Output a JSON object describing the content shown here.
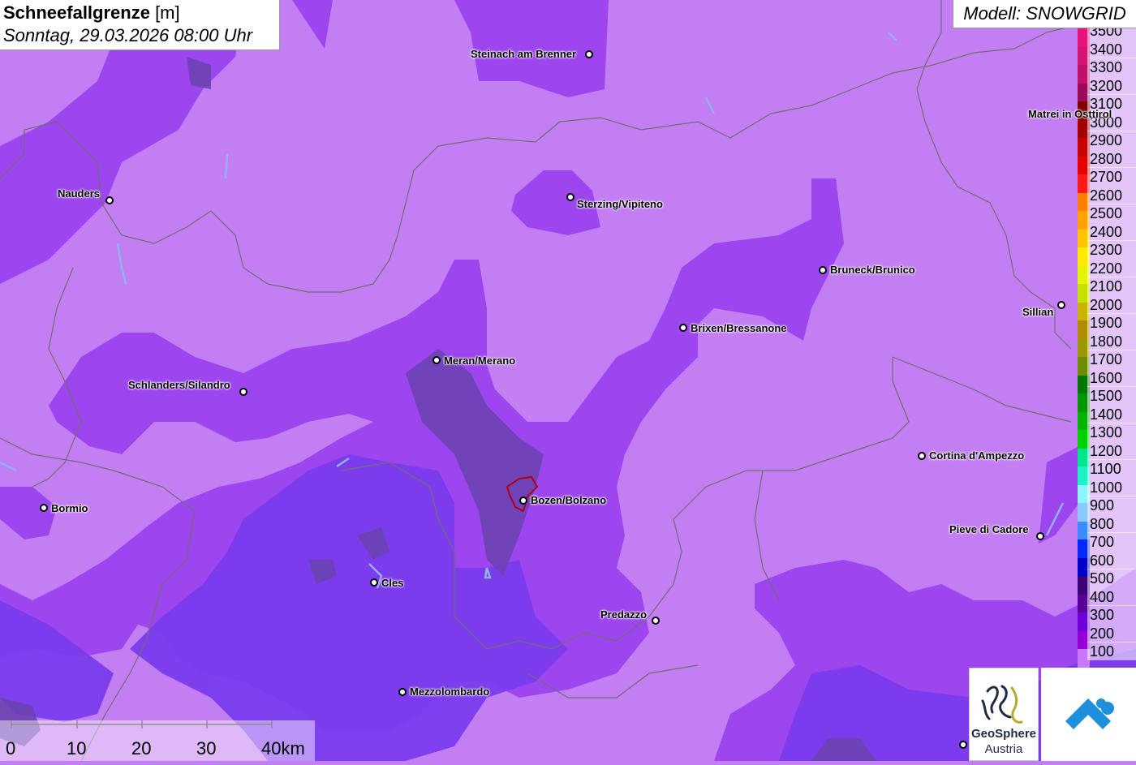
{
  "title": {
    "bold": "Schneefallgrenze",
    "unit": " [m]",
    "subtitle": "Sonntag, 29.03.2026 08:00 Uhr"
  },
  "model": "Modell: SNOWGRID",
  "legend": {
    "items": [
      {
        "label": "3500",
        "color": "#e8137b"
      },
      {
        "label": "3400",
        "color": "#d41372"
      },
      {
        "label": "3300",
        "color": "#c0106a"
      },
      {
        "label": "3200",
        "color": "#9c0b5a"
      },
      {
        "label": "3100",
        "color": "#7f0000"
      },
      {
        "label": "3000",
        "color": "#a50000"
      },
      {
        "label": "2900",
        "color": "#c80000"
      },
      {
        "label": "2800",
        "color": "#e60000"
      },
      {
        "label": "2700",
        "color": "#ff1a1a"
      },
      {
        "label": "2600",
        "color": "#ff7f00"
      },
      {
        "label": "2500",
        "color": "#ffa100"
      },
      {
        "label": "2400",
        "color": "#ffc400"
      },
      {
        "label": "2300",
        "color": "#ffea00"
      },
      {
        "label": "2200",
        "color": "#e4f500"
      },
      {
        "label": "2100",
        "color": "#c6e000"
      },
      {
        "label": "2000",
        "color": "#c8b400"
      },
      {
        "label": "1900",
        "color": "#b08c00"
      },
      {
        "label": "1800",
        "color": "#9a9a00"
      },
      {
        "label": "1700",
        "color": "#6e8c00"
      },
      {
        "label": "1600",
        "color": "#007800"
      },
      {
        "label": "1500",
        "color": "#009600"
      },
      {
        "label": "1400",
        "color": "#00b400"
      },
      {
        "label": "1300",
        "color": "#00d200"
      },
      {
        "label": "1200",
        "color": "#00e68c"
      },
      {
        "label": "1100",
        "color": "#1ef0c8"
      },
      {
        "label": "1000",
        "color": "#8cf5ff"
      },
      {
        "label": "900",
        "color": "#8cc8ff"
      },
      {
        "label": "800",
        "color": "#3c8cff"
      },
      {
        "label": "700",
        "color": "#0028ff"
      },
      {
        "label": "600",
        "color": "#0000c8"
      },
      {
        "label": "500",
        "color": "#3c0078"
      },
      {
        "label": "400",
        "color": "#5a0096"
      },
      {
        "label": "300",
        "color": "#6e00dc"
      },
      {
        "label": "200",
        "color": "#9600d2"
      },
      {
        "label": "100",
        "color": "#c878ff"
      }
    ]
  },
  "cities": [
    {
      "name": "Steinach am Brenner"
    },
    {
      "name": "Nauders"
    },
    {
      "name": "Sterzing/Vipiteno"
    },
    {
      "name": "Matrei in Osttirol"
    },
    {
      "name": "Bruneck/Brunico"
    },
    {
      "name": "Brixen/Bressanone"
    },
    {
      "name": "Sillian"
    },
    {
      "name": "Meran/Merano"
    },
    {
      "name": "Schlanders/Silandro"
    },
    {
      "name": "Cortina d'Ampezzo"
    },
    {
      "name": "Bozen/Bolzano"
    },
    {
      "name": "Bormio"
    },
    {
      "name": "Pieve di Cadore"
    },
    {
      "name": "Cles"
    },
    {
      "name": "Predazzo"
    },
    {
      "name": "Mezzolombardo"
    }
  ],
  "scale": {
    "labels": [
      "0",
      "10",
      "20",
      "30",
      "40km"
    ]
  },
  "logos": {
    "geosphere_line1": "GeoSphere",
    "geosphere_line2": "Austria"
  },
  "colors": {
    "background": "#c47ef3",
    "band_magenta": "#9c3df0",
    "band_violet": "#7a38ee",
    "band_dark": "#6a3fb5",
    "border": "#666666",
    "river": "#8fb4f0",
    "bolzano_outline": "#c00000"
  }
}
